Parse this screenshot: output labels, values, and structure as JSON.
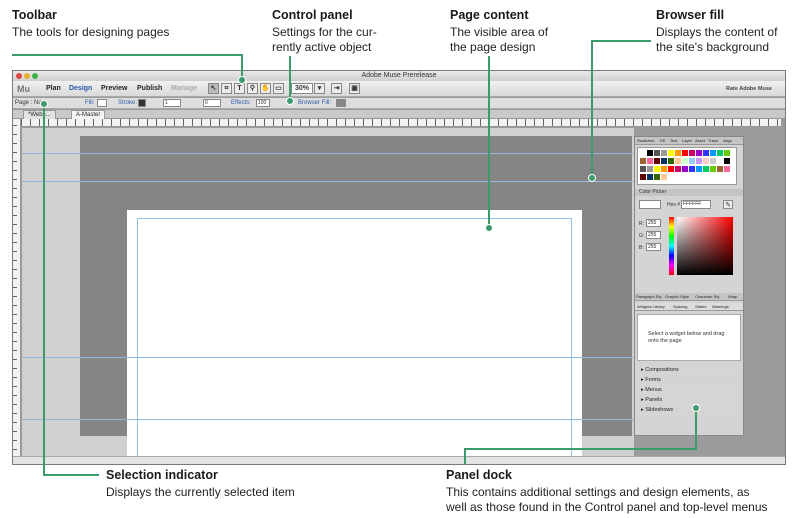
{
  "annotations": {
    "toolbar": {
      "title": "Toolbar",
      "desc": "The tools for designing pages"
    },
    "control_panel": {
      "title": "Control panel",
      "desc1": "Settings for the cur-",
      "desc2": "rently active object"
    },
    "page_content": {
      "title": "Page content",
      "desc1": "The visible area of",
      "desc2": "the page design"
    },
    "browser_fill": {
      "title": "Browser fill",
      "desc1": "Displays the content of",
      "desc2": "the site's background"
    },
    "selection_indicator": {
      "title": "Selection indicator",
      "desc": "Displays the currently selected item"
    },
    "panel_dock": {
      "title": "Panel dock",
      "desc1": "This contains additional settings and design elements, as",
      "desc2": "well as those found in the Control panel and top-level menus"
    }
  },
  "app": {
    "window_title": "Adobe Muse Prerelease",
    "logo": "Mu",
    "menus": [
      "Plan",
      "Design",
      "Preview",
      "Publish",
      "Manage"
    ],
    "rate": "Rate Adobe Muse",
    "zoom": "30%"
  },
  "control_bar": {
    "page_label": "Page : No...",
    "fill_label": "Fill:",
    "stroke_label": "Stroke:",
    "stroke_value": "1",
    "corner_value": "0",
    "effects_label": "Effects:",
    "opacity_value": "100",
    "browser_fill_label": "Browser Fill:"
  },
  "tabs": [
    "*Webs...",
    "A-Master"
  ],
  "dock": {
    "swatch_tabs": [
      "Swatches",
      "Fill",
      "Text",
      "Layer",
      "Asset",
      "Trans",
      "Align"
    ],
    "color_picker_label": "Color Picker",
    "hex_label": "Hex #",
    "hex_value": "FFFFFF",
    "r_label": "R:",
    "r_value": "255",
    "g_label": "G:",
    "g_value": "255",
    "b_label": "B:",
    "b_value": "255",
    "style_tabs": [
      "Paragraph Sty",
      "Graphic Style",
      "Character Sty",
      "Wrap"
    ],
    "widget_tabs": [
      "Widgets Library",
      "Spacing",
      "States",
      "Warnings"
    ],
    "widget_hint": "Select a widget below and drag onto the page",
    "widget_groups": [
      "Compositions",
      "Forms",
      "Menus",
      "Panels",
      "Slideshows"
    ]
  },
  "colors": {
    "accent": "#3d9a6a",
    "browser_fill": "#858585",
    "guide": "#8fc2e6"
  }
}
